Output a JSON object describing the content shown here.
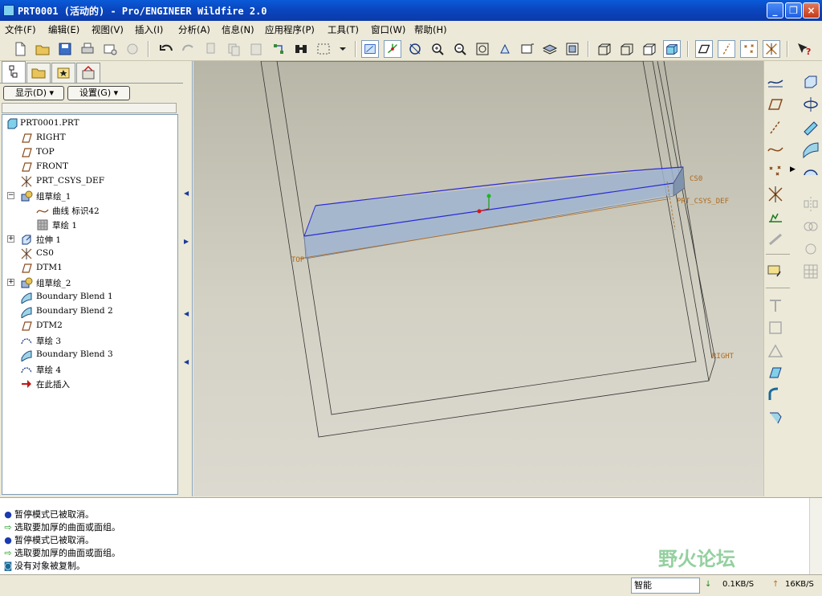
{
  "window": {
    "title": "PRT0001 (活动的) - Pro/ENGINEER Wildfire 2.0",
    "min_label": "_",
    "max_label": "❐",
    "close_label": "×"
  },
  "menu": [
    {
      "label": "文件(F)"
    },
    {
      "label": "编辑(E)"
    },
    {
      "label": "视图(V)"
    },
    {
      "label": "插入(I)"
    },
    {
      "label": "分析(A)"
    },
    {
      "label": "信息(N)"
    },
    {
      "label": "应用程序(P)"
    },
    {
      "label": "工具(T)"
    },
    {
      "label": "窗口(W)"
    },
    {
      "label": "帮助(H)"
    }
  ],
  "panel": {
    "show_dropdown": "显示(D) ▾",
    "settings_dropdown": "设置(G) ▾"
  },
  "tree": [
    {
      "label": "PRT0001.PRT",
      "icon": "part-icon"
    },
    {
      "label": "RIGHT",
      "icon": "datum-plane-icon"
    },
    {
      "label": "TOP",
      "icon": "datum-plane-icon"
    },
    {
      "label": "FRONT",
      "icon": "datum-plane-icon"
    },
    {
      "label": "PRT_CSYS_DEF",
      "icon": "csys-icon"
    },
    {
      "label": "组草绘_1",
      "icon": "sketch-group-icon",
      "expander": "−"
    },
    {
      "label": "曲线 标识42",
      "icon": "curve-icon"
    },
    {
      "label": "草绘 1",
      "icon": "sketch-icon"
    },
    {
      "label": "拉伸 1",
      "icon": "extrude-icon",
      "expander": "+"
    },
    {
      "label": "CS0",
      "icon": "csys-icon"
    },
    {
      "label": "DTM1",
      "icon": "datum-plane-icon"
    },
    {
      "label": "组草绘_2",
      "icon": "sketch-group-icon",
      "expander": "+"
    },
    {
      "label": "Boundary Blend 1",
      "icon": "boundary-blend-icon"
    },
    {
      "label": "Boundary Blend 2",
      "icon": "boundary-blend-icon"
    },
    {
      "label": "DTM2",
      "icon": "datum-plane-icon"
    },
    {
      "label": "草绘 3",
      "icon": "sketch-icon"
    },
    {
      "label": "Boundary Blend 3",
      "icon": "boundary-blend-icon"
    },
    {
      "label": "草绘 4",
      "icon": "sketch-icon"
    },
    {
      "label": "在此插入",
      "icon": "insert-here-icon"
    }
  ],
  "viewport": {
    "labels": {
      "cs0": "CS0",
      "prt_csys": "PRT_CSYS_DEF",
      "top": "TOP",
      "right": "RIGHT"
    }
  },
  "messages": [
    {
      "icon": "bullet",
      "text": "暂停模式已被取消。"
    },
    {
      "icon": "arrow",
      "text": "选取要加厚的曲面或面组。"
    },
    {
      "icon": "bullet",
      "text": "暂停模式已被取消。"
    },
    {
      "icon": "arrow",
      "text": "选取要加厚的曲面或面组。"
    },
    {
      "icon": "info",
      "text": "没有对象被复制。"
    }
  ],
  "status": {
    "filter": "智能",
    "down_rate": "0.1KB/S",
    "up_rate": "16KB/S",
    "watermark": "野火论坛"
  },
  "colors": {
    "title_bar": "#0a46c0",
    "surface_fill": "#9fb4d0",
    "surface_edge": "#2a2ad8",
    "datum_orange": "#b06a1e"
  }
}
